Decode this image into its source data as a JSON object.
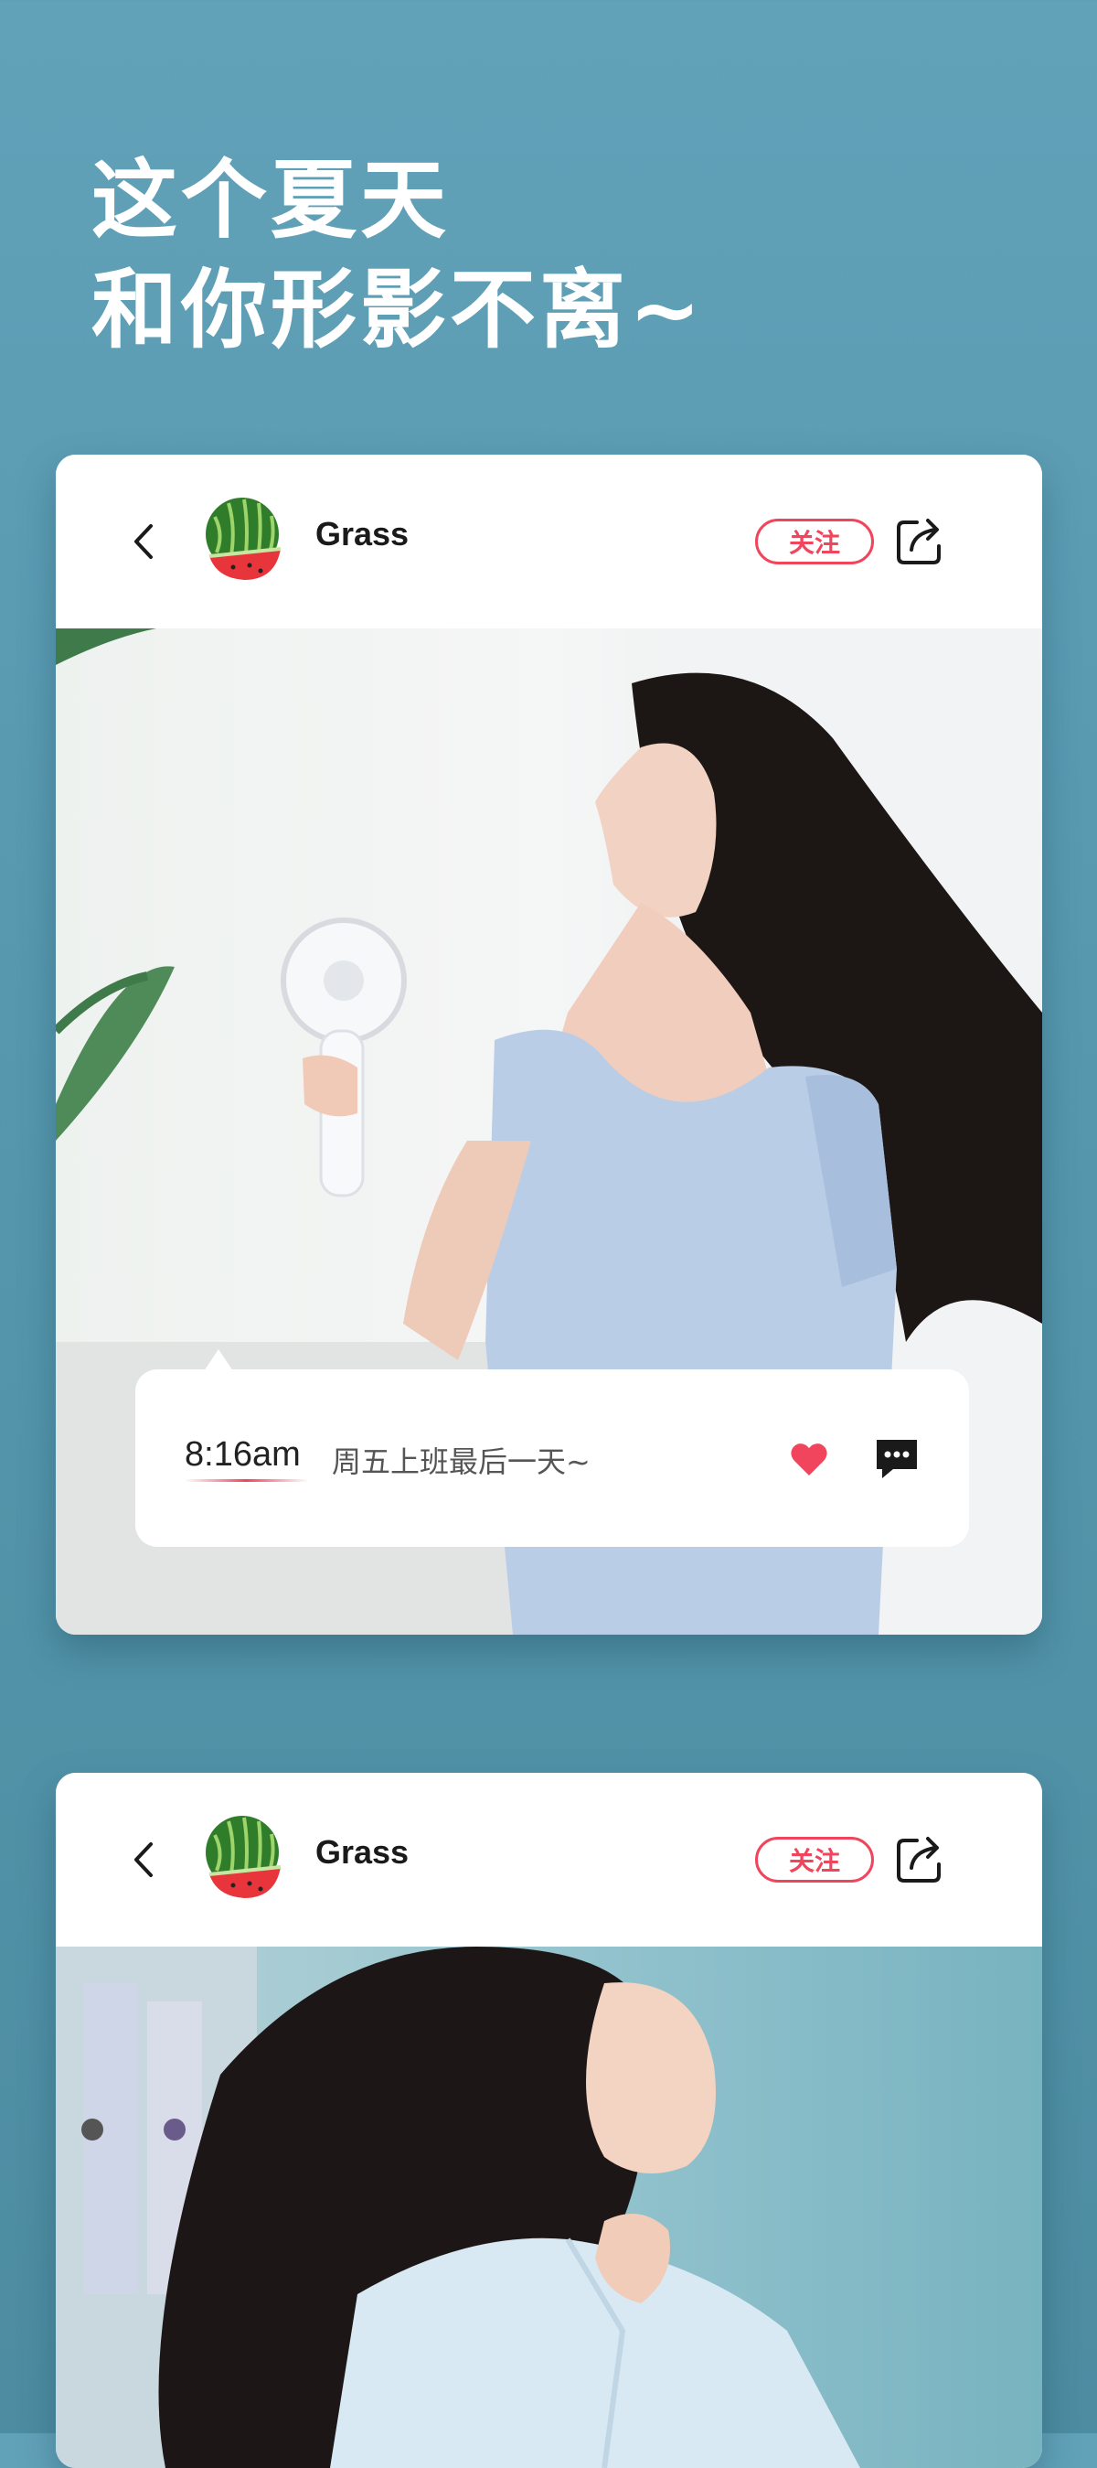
{
  "headline": {
    "line1": "这个夏天",
    "line2": "和你形影不离~"
  },
  "posts": [
    {
      "username": "Grass",
      "follow_label": "关注",
      "avatar_icon": "watermelon-avatar",
      "caption": {
        "time": "8:16am",
        "text": "周五上班最后一天~"
      },
      "actions": [
        "heart-icon",
        "comment-icon"
      ]
    },
    {
      "username": "Grass",
      "follow_label": "关注",
      "avatar_icon": "watermelon-avatar"
    }
  ],
  "colors": {
    "background": "#5b9cb2",
    "accent": "#f0455c",
    "card": "#ffffff"
  }
}
